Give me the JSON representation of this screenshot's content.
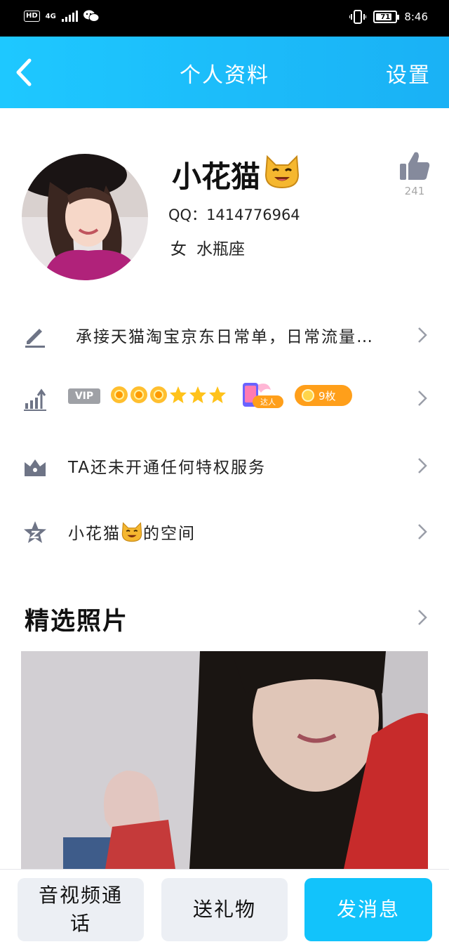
{
  "status_bar": {
    "hd": "HD",
    "network": "4G",
    "battery": "71",
    "time": "8:46"
  },
  "header": {
    "title": "个人资料",
    "settings_label": "设置"
  },
  "profile": {
    "name": "小花猫",
    "name_emoji": "😺",
    "qq_label": "QQ：",
    "qq_number": "1414776964",
    "gender": "女",
    "zodiac": "水瓶座",
    "likes": "241"
  },
  "rows": {
    "signature": "承接天猫淘宝京东日常单，日常流量…",
    "vip_tag": "VIP",
    "daren_label": "达人",
    "coin_count": "9枚",
    "privilege": "TA还未开通任何特权服务",
    "space_prefix": "小花猫",
    "space_emoji": "😺",
    "space_suffix": "的空间"
  },
  "photos": {
    "section_title": "精选照片"
  },
  "bottom_bar": {
    "call": "音视频通话",
    "gift": "送礼物",
    "message": "发消息"
  },
  "colors": {
    "header": "#1ec8ff",
    "primary_button": "#12c3fb",
    "secondary_button": "#eceff4",
    "icon_grey": "#6e7486",
    "coin_orange": "#ff9f1a"
  }
}
